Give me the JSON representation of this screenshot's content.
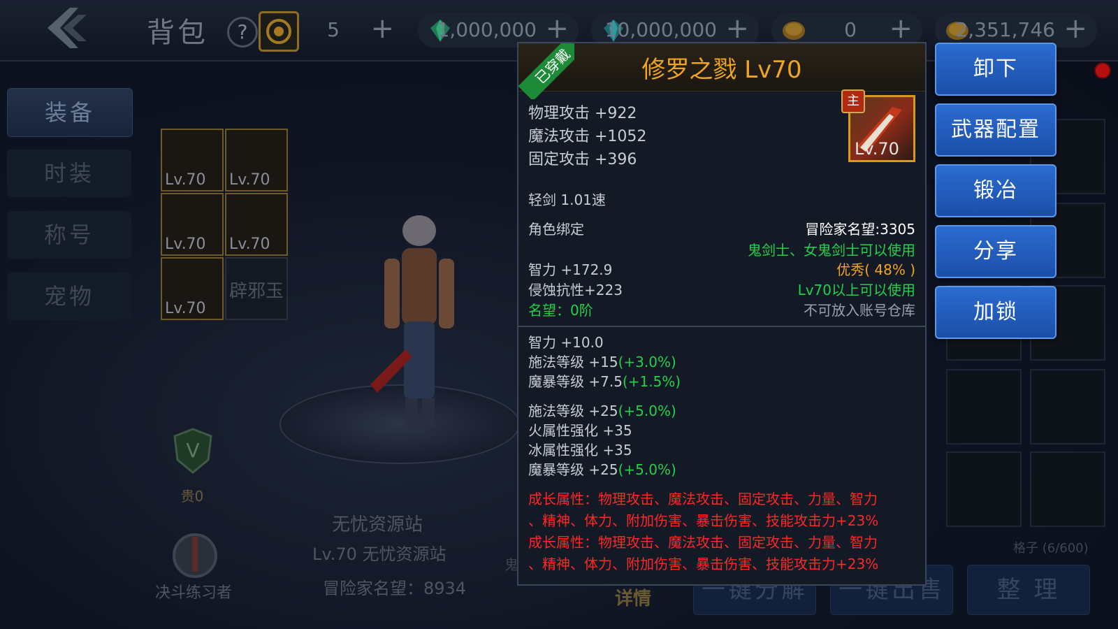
{
  "header": {
    "title": "背包",
    "help": "?",
    "currencies": [
      {
        "icon": "coin-slot-icon",
        "value": "5"
      },
      {
        "icon": "green-gem-icon",
        "value": "1,000,000"
      },
      {
        "icon": "green-gem-2-icon",
        "value": "10,000,000"
      },
      {
        "icon": "gold-coin-icon",
        "value": "0"
      },
      {
        "icon": "gold-coin-2-icon",
        "value": "2,351,746"
      }
    ],
    "plus": "+"
  },
  "tabs": [
    "装备",
    "时装",
    "称号",
    "宠物"
  ],
  "equipment": [
    {
      "lv": "Lv.70"
    },
    {
      "lv": "Lv.70"
    },
    {
      "lv": "Lv.70"
    },
    {
      "lv": "Lv.70"
    },
    {
      "lv": "Lv.70"
    },
    {
      "slot_text": "辟邪玉"
    }
  ],
  "character": {
    "guild": "无忧资源站",
    "level_name": "Lv.70 无忧资源站",
    "reputation": "冒险家名望：8934",
    "noble": "贵0",
    "duel_rank": "决斗练习者",
    "detail": "详情",
    "partial_label": "鬼"
  },
  "inventory": {
    "count": "格子 (6/600)",
    "bottom_buttons": [
      "一键分解",
      "一键出售",
      "整 理"
    ]
  },
  "tooltip": {
    "worn_ribbon": "已穿戴",
    "title": "修罗之戮 Lv70",
    "icon_level": "Lv.70",
    "main_badge": "主",
    "base_stats": [
      "物理攻击 +922",
      "魔法攻击 +1052",
      "固定攻击 +396"
    ],
    "weapon_type": "轻剑 1.01速",
    "bind": "角色绑定",
    "adventurer_rep": "冒险家名望:3305",
    "usable_class": "鬼剑士、女鬼剑士可以使用",
    "quality": "优秀( 48% )",
    "level_req": "Lv70以上可以使用",
    "storage": "不可放入账号仓库",
    "int": "智力 +172.9",
    "erosion": "侵蚀抗性+223",
    "fame": "名望：0阶",
    "extra1": [
      {
        "text": "智力 +10.0",
        "pct": ""
      },
      {
        "text": "施法等级 +15",
        "pct": "(+3.0%)"
      },
      {
        "text": "魔暴等级 +7.5",
        "pct": "(+1.5%)"
      }
    ],
    "extra2": [
      {
        "text": "施法等级 +25",
        "pct": "(+5.0%)"
      },
      {
        "text": "火属性强化 +35",
        "pct": ""
      },
      {
        "text": "冰属性强化 +35",
        "pct": ""
      },
      {
        "text": "魔暴等级 +25",
        "pct": "(+5.0%)"
      }
    ],
    "growth": [
      "成长属性：物理攻击、魔法攻击、固定攻击、力量、智力",
      "、精神、体力、附加伤害、暴击伤害、技能攻击力+23%",
      "成长属性：物理攻击、魔法攻击、固定攻击、力量、智力",
      "、精神、体力、附加伤害、暴击伤害、技能攻击力+23%"
    ]
  },
  "actions": [
    "卸下",
    "武器配置",
    "锻冶",
    "分享",
    "加锁"
  ],
  "colors": {
    "accent_blue": "#2c6bd0",
    "title_orange": "#f0a422",
    "green": "#22d04a",
    "red": "#ff2626"
  }
}
